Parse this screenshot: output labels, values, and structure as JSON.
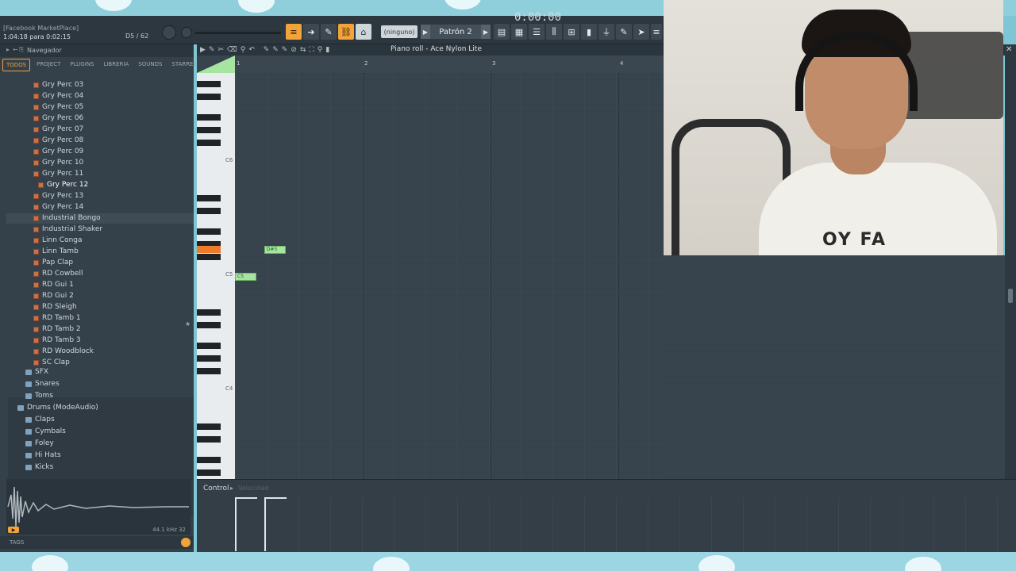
{
  "topbar": {
    "hint_line1": "[Facebook MarketPlace]",
    "hint_line2": "1:04:18 para 0:02:15",
    "counter": "D5 / 62",
    "pattern_selector": "(ninguno)",
    "pattern_name": "Patrón 2",
    "time_display": "0:00:00"
  },
  "browser": {
    "title": "Navegador",
    "tabs": [
      "TODOS",
      "PROJECT",
      "PLUGINS",
      "LIBRERIA",
      "SOUNDS",
      "STARRED"
    ],
    "active_tab": "TODOS",
    "files": [
      "Gry Perc 03",
      "Gry Perc 04",
      "Gry Perc 05",
      "Gry Perc 06",
      "Gry Perc 07",
      "Gry Perc 08",
      "Gry Perc 09",
      "Gry Perc 10",
      "Gry Perc 11",
      "Gry Perc 12",
      "Gry Perc 13",
      "Gry Perc 14",
      "Industrial Bongo",
      "Industrial Shaker",
      "Linn Conga",
      "Linn Tamb",
      "Pap Clap",
      "RD Cowbell",
      "RD Gui 1",
      "RD Gui 2",
      "RD Sleigh",
      "RD Tamb 1",
      "RD Tamb 2",
      "RD Tamb 3",
      "RD Woodblock",
      "SC Clap"
    ],
    "selected_file": "Gry Perc 12",
    "folders_a": [
      "SFX",
      "Snares",
      "Toms"
    ],
    "pack_name": "Drums (ModeAudio)",
    "folders_b": [
      "Claps",
      "Cymbals",
      "Foley",
      "Hi Hats",
      "Kicks"
    ],
    "sample_info": "44.1 kHz 32",
    "tags_label": "TAGS"
  },
  "piano_roll": {
    "title": "Piano roll",
    "instrument": "Ace Nylon Lite",
    "ruler_numbers": [
      "1",
      "2",
      "3",
      "4"
    ],
    "key_labels": [
      "C6",
      "C5",
      "C4"
    ],
    "notes": [
      {
        "pitch": "C5",
        "label": "C5",
        "start_step": 0,
        "length_steps": 1.5
      },
      {
        "pitch": "D#5",
        "label": "D#5",
        "start_step": 2.3,
        "length_steps": 1.5
      }
    ]
  },
  "control": {
    "label": "Control",
    "sublabel": "Velocidad"
  },
  "colors": {
    "accent": "#f2a33a",
    "note": "#a6e59f",
    "panel": "#37434d"
  }
}
